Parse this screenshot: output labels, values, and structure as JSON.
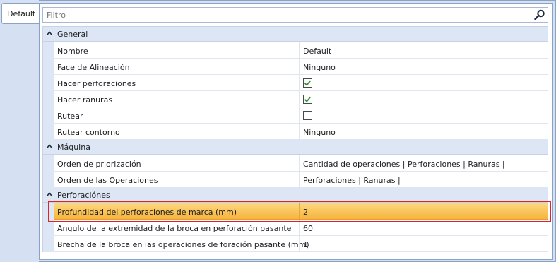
{
  "tab": {
    "label": "Default"
  },
  "filter": {
    "placeholder": "Filtro"
  },
  "icons": {
    "search": "search-icon",
    "check": "check-icon",
    "collapse": "chevron-up-icon"
  },
  "colors": {
    "selection": "#f9c660",
    "highlight_border": "#e0202a",
    "category_bg": "#dce6f4",
    "check_green": "#2e9a3a"
  },
  "categories": [
    {
      "label": "General",
      "rows": [
        {
          "name": "Nombre",
          "value": "Default",
          "type": "text"
        },
        {
          "name": "Face de Alineación",
          "value": "Ninguno",
          "type": "text"
        },
        {
          "name": "Hacer perforaciones",
          "value": "",
          "checked": true,
          "type": "checkbox"
        },
        {
          "name": "Hacer ranuras",
          "value": "",
          "checked": true,
          "type": "checkbox"
        },
        {
          "name": "Rutear",
          "value": "",
          "checked": false,
          "type": "checkbox"
        },
        {
          "name": "Rutear contorno",
          "value": "Ninguno",
          "type": "text"
        }
      ]
    },
    {
      "label": "Máquina",
      "rows": [
        {
          "name": "Orden de priorización",
          "value": "Cantidad de operaciones | Perforaciones | Ranuras |",
          "type": "text"
        },
        {
          "name": "Orden de las Operaciones",
          "value": "Perforaciones | Ranuras |",
          "type": "text"
        }
      ]
    },
    {
      "label": "Perforaciónes",
      "rows": [
        {
          "name": "Profundidad del perforaciones de marca (mm)",
          "value": "2",
          "type": "text",
          "selected": true
        },
        {
          "name": "Angulo de la extremidad de la broca en perforación pasante",
          "value": "60",
          "type": "text"
        },
        {
          "name": "Brecha de la broca en las operaciones de foración pasante (mm)",
          "value": "1",
          "type": "text"
        }
      ]
    }
  ]
}
